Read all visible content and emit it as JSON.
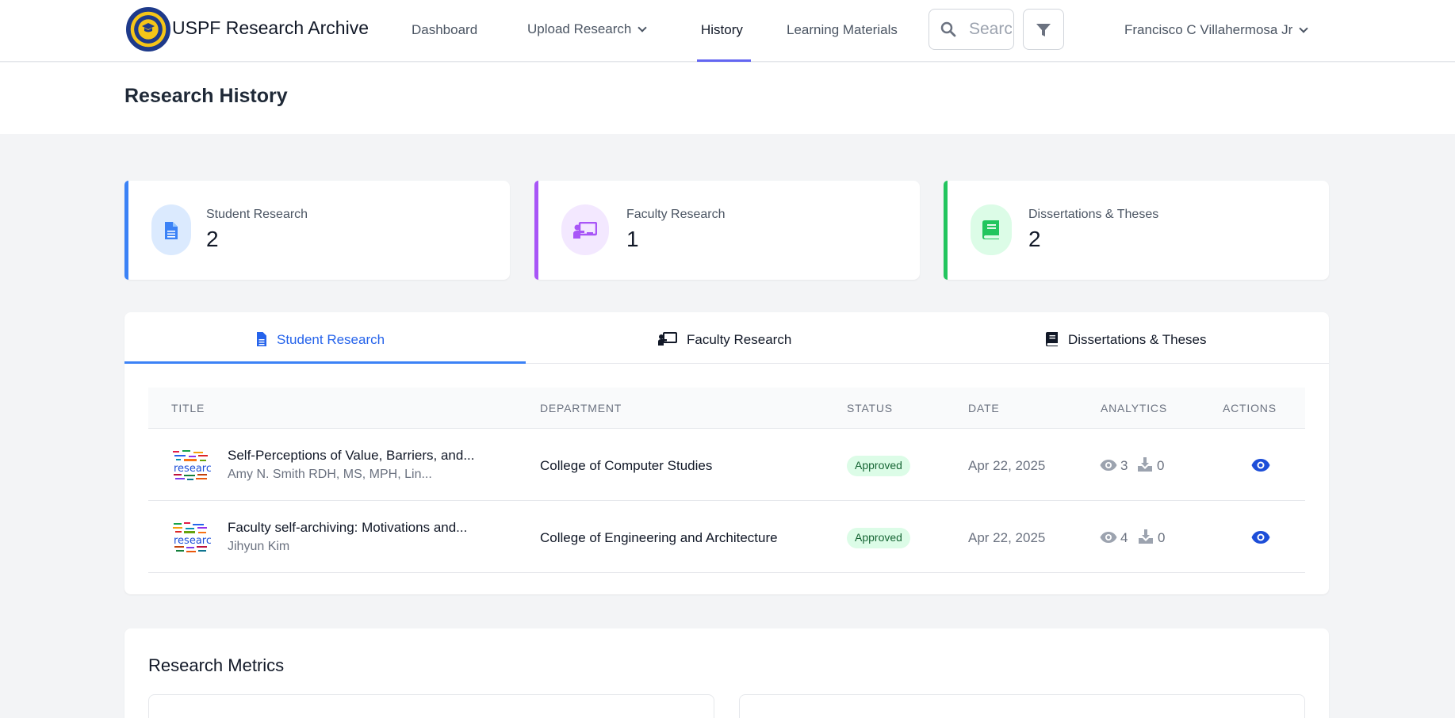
{
  "nav": {
    "brand": "USPF Research Archive",
    "links": {
      "dashboard": "Dashboard",
      "upload": "Upload Research",
      "history": "History",
      "learning": "Learning Materials"
    },
    "search_placeholder": "Search",
    "user_name": "Francisco C Villahermosa Jr"
  },
  "header": {
    "title": "Research History"
  },
  "stats": [
    {
      "label": "Student Research",
      "value": "2",
      "color": "#3b82f6",
      "bg": "#dbeafe",
      "icon": "document-icon"
    },
    {
      "label": "Faculty Research",
      "value": "1",
      "color": "#a855f7",
      "bg": "#f3e8ff",
      "icon": "presentation-icon"
    },
    {
      "label": "Dissertations & Theses",
      "value": "2",
      "color": "#22c55e",
      "bg": "#dcfce7",
      "icon": "book-icon"
    }
  ],
  "tabs": [
    {
      "label": "Student Research",
      "active": true
    },
    {
      "label": "Faculty Research",
      "active": false
    },
    {
      "label": "Dissertations & Theses",
      "active": false
    }
  ],
  "table": {
    "headers": {
      "title": "TITLE",
      "department": "DEPARTMENT",
      "status": "STATUS",
      "date": "DATE",
      "analytics": "ANALYTICS",
      "actions": "ACTIONS"
    },
    "rows": [
      {
        "title": "Self-Perceptions of Value, Barriers, and...",
        "author": "Amy N. Smith RDH, MS, MPH, Lin...",
        "department": "College of Computer Studies",
        "status": "Approved",
        "date": "Apr 22, 2025",
        "views": "3",
        "downloads": "0"
      },
      {
        "title": "Faculty self-archiving: Motivations and...",
        "author": "Jihyun Kim",
        "department": "College of Engineering and Architecture",
        "status": "Approved",
        "date": "Apr 22, 2025",
        "views": "4",
        "downloads": "0"
      }
    ]
  },
  "metrics": {
    "title": "Research Metrics"
  },
  "colors": {
    "accent_blue": "#2563eb",
    "status_green": "#166534"
  }
}
